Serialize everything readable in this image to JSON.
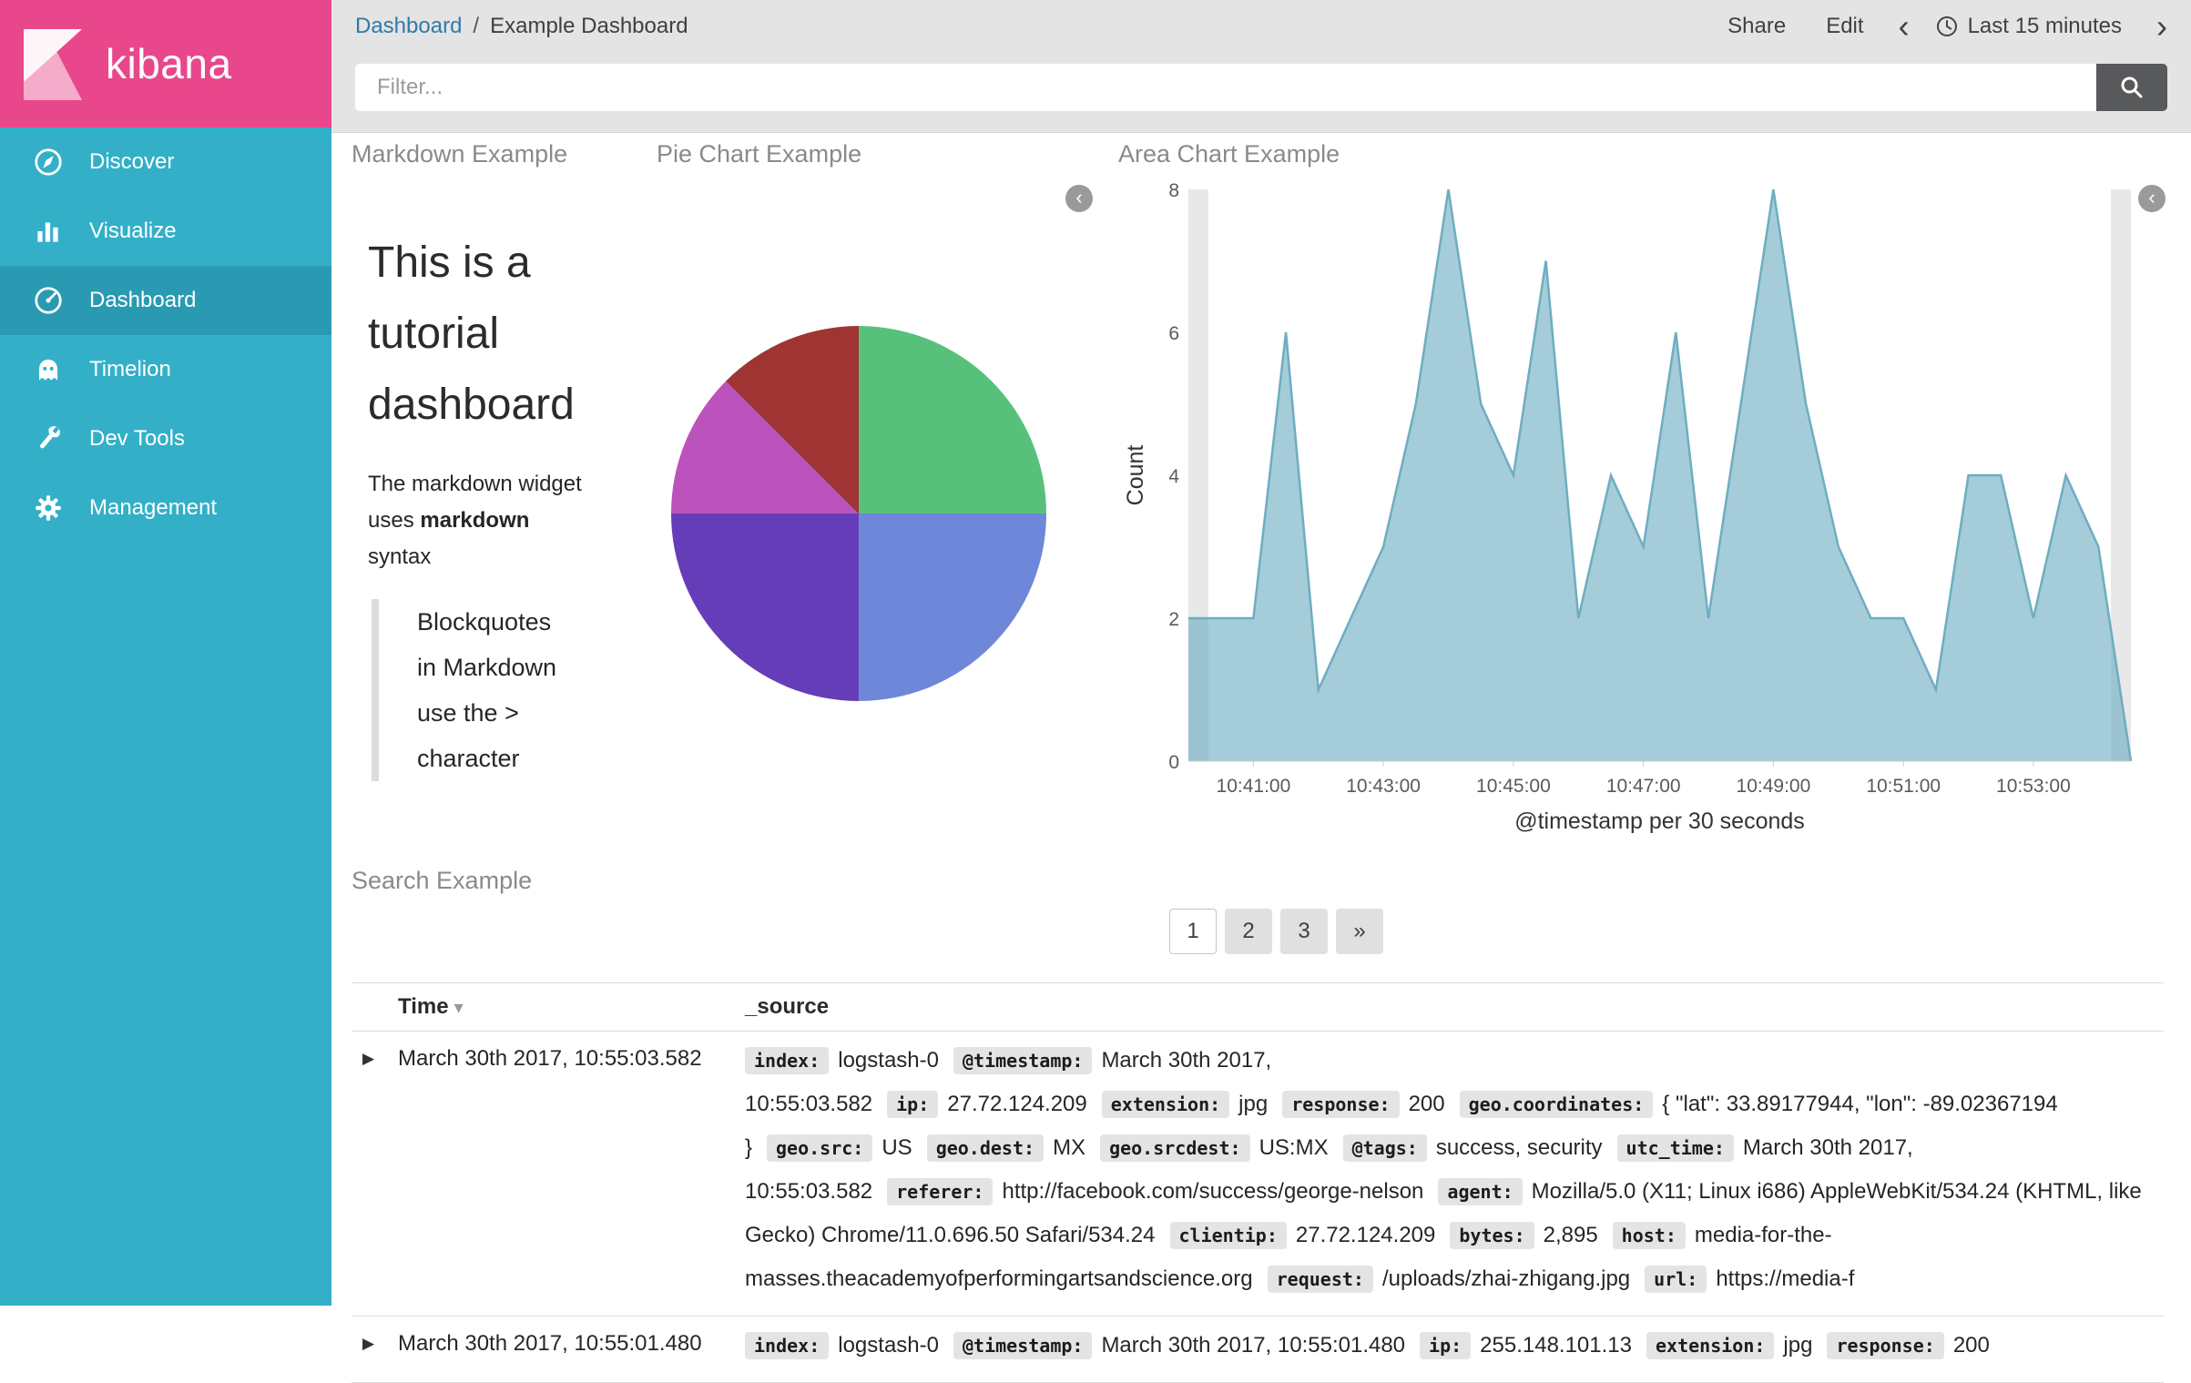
{
  "colors": {
    "sidebar": "#33b0c8",
    "sidebar_selected": "#2a9ab3",
    "brand_pink": "#e8488b",
    "link": "#2d7ba9",
    "area_fill": "#6eadc1"
  },
  "icons": {
    "row_caret": "▶",
    "sort_caret": "▾",
    "panel_collapse": "‹"
  },
  "sidebar": {
    "logo": "kibana",
    "items": [
      {
        "label": "Discover",
        "selected": false
      },
      {
        "label": "Visualize",
        "selected": false
      },
      {
        "label": "Dashboard",
        "selected": true
      },
      {
        "label": "Timelion",
        "selected": false
      },
      {
        "label": "Dev Tools",
        "selected": false
      },
      {
        "label": "Management",
        "selected": false
      }
    ]
  },
  "topbar": {
    "breadcrumb_link": "Dashboard",
    "breadcrumb_sep": "/",
    "breadcrumb_current": "Example Dashboard",
    "share": "Share",
    "edit": "Edit",
    "prev": "‹",
    "next": "›",
    "time_range": "Last 15 minutes"
  },
  "filter": {
    "placeholder": "Filter..."
  },
  "markdown_panel": {
    "title": "Markdown Example",
    "heading": "This is a tutorial dashboard",
    "para_1": "The markdown widget uses ",
    "para_bold": "markdown",
    "para_2": " syntax",
    "blockquote": "Blockquotes in Markdown use the > character"
  },
  "pie_panel": {
    "title": "Pie Chart Example",
    "chart_data": {
      "type": "pie",
      "slices": [
        {
          "color": "#57c17b",
          "fraction": 0.25
        },
        {
          "color": "#6f87d8",
          "fraction": 0.25
        },
        {
          "color": "#663db8",
          "fraction": 0.25
        },
        {
          "color": "#bc52bc",
          "fraction": 0.125
        },
        {
          "color": "#9e3533",
          "fraction": 0.125
        }
      ]
    }
  },
  "area_panel": {
    "title": "Area Chart Example",
    "chart_data": {
      "type": "area",
      "title": "Area Chart Example",
      "ylabel": "Count",
      "xlabel": "@timestamp per 30 seconds",
      "ylim": [
        0,
        8
      ],
      "yticks": [
        0,
        2,
        4,
        6,
        8
      ],
      "xtick_labels": [
        "10:41:00",
        "10:43:00",
        "10:45:00",
        "10:47:00",
        "10:49:00",
        "10:51:00",
        "10:53:00"
      ],
      "fill_color": "#6eadc1",
      "x": [
        "10:40:00",
        "10:40:30",
        "10:41:00",
        "10:41:30",
        "10:42:00",
        "10:42:30",
        "10:43:00",
        "10:43:30",
        "10:44:00",
        "10:44:30",
        "10:45:00",
        "10:45:30",
        "10:46:00",
        "10:46:30",
        "10:47:00",
        "10:47:30",
        "10:48:00",
        "10:48:30",
        "10:49:00",
        "10:49:30",
        "10:50:00",
        "10:50:30",
        "10:51:00",
        "10:51:30",
        "10:52:00",
        "10:52:30",
        "10:53:00",
        "10:53:30",
        "10:54:00",
        "10:54:30"
      ],
      "values": [
        2,
        2,
        2,
        6,
        1,
        2,
        3,
        5,
        8,
        5,
        4,
        7,
        2,
        4,
        3,
        6,
        2,
        5,
        8,
        5,
        3,
        2,
        2,
        1,
        4,
        4,
        2,
        4,
        3,
        0
      ]
    }
  },
  "search_panel": {
    "title": "Search Example",
    "pagination": [
      "1",
      "2",
      "3",
      "»"
    ],
    "columns": {
      "time": "Time",
      "source": "_source"
    },
    "rows": [
      {
        "time": "March 30th 2017, 10:55:03.582",
        "fields": [
          {
            "k": "index:",
            "v": "logstash-0"
          },
          {
            "k": "@timestamp:",
            "v": "March 30th 2017, 10:55:03.582"
          },
          {
            "k": "ip:",
            "v": "27.72.124.209"
          },
          {
            "k": "extension:",
            "v": "jpg"
          },
          {
            "k": "response:",
            "v": "200"
          },
          {
            "k": "geo.coordinates:",
            "v": "{ \"lat\": 33.89177944, \"lon\": -89.02367194 }"
          },
          {
            "k": "geo.src:",
            "v": "US"
          },
          {
            "k": "geo.dest:",
            "v": "MX"
          },
          {
            "k": "geo.srcdest:",
            "v": "US:MX"
          },
          {
            "k": "@tags:",
            "v": "success, security"
          },
          {
            "k": "utc_time:",
            "v": "March 30th 2017, 10:55:03.582"
          },
          {
            "k": "referer:",
            "v": "http://facebook.com/success/george-nelson"
          },
          {
            "k": "agent:",
            "v": "Mozilla/5.0 (X11; Linux i686) AppleWebKit/534.24 (KHTML, like Gecko) Chrome/11.0.696.50 Safari/534.24"
          },
          {
            "k": "clientip:",
            "v": "27.72.124.209"
          },
          {
            "k": "bytes:",
            "v": "2,895"
          },
          {
            "k": "host:",
            "v": "media-for-the-masses.theacademyofperformingartsandscience.org"
          },
          {
            "k": "request:",
            "v": "/uploads/zhai-zhigang.jpg"
          },
          {
            "k": "url:",
            "v": "https://media-f"
          }
        ]
      },
      {
        "time": "March 30th 2017, 10:55:01.480",
        "fields": [
          {
            "k": "index:",
            "v": "logstash-0"
          },
          {
            "k": "@timestamp:",
            "v": "March 30th 2017, 10:55:01.480"
          },
          {
            "k": "ip:",
            "v": "255.148.101.13"
          },
          {
            "k": "extension:",
            "v": "jpg"
          },
          {
            "k": "response:",
            "v": "200"
          }
        ]
      }
    ]
  }
}
